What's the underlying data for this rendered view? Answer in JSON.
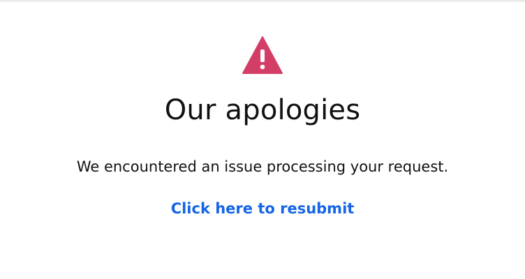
{
  "error": {
    "icon": "warning-triangle-icon",
    "icon_color": "#d33e67",
    "title": "Our apologies",
    "message": "We encountered an issue processing your request.",
    "link_label": "Click here to resubmit",
    "link_color": "#1565e6"
  }
}
